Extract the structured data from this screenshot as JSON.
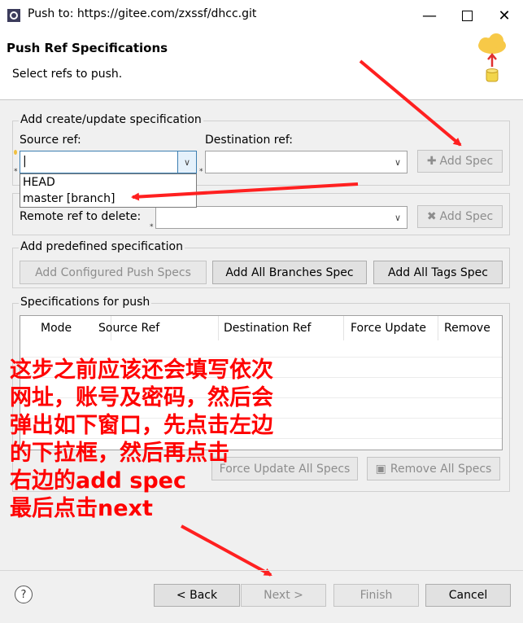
{
  "window": {
    "title": "Push to: https://gitee.com/zxssf/dhcc.git"
  },
  "header": {
    "title": "Push Ref Specifications",
    "description": "Select refs to push."
  },
  "create_update": {
    "group_label": "Add create/update specification",
    "source_label": "Source ref:",
    "source_value": "|",
    "destination_label": "Destination ref:",
    "add_spec_label": "Add Spec",
    "dropdown_items": [
      "HEAD",
      "master [branch]"
    ]
  },
  "delete": {
    "remote_label": "Remote ref to delete:",
    "add_spec_label": "Add Spec"
  },
  "predefined": {
    "group_label": "Add predefined specification",
    "configured_label": "Add Configured Push Specs",
    "all_branches_label": "Add All Branches Spec",
    "all_tags_label": "Add All Tags Spec"
  },
  "specs": {
    "group_label": "Specifications for push",
    "columns": [
      "Mode",
      "Source Ref",
      "Destination Ref",
      "Force Update",
      "Remove"
    ],
    "force_all_label": "Force Update All Specs",
    "remove_all_label": "Remove All Specs"
  },
  "annotation": {
    "lines": [
      "这步之前应该还会填写依次",
      "网址，账号及密码，然后会",
      "弹出如下窗口，先点击左边",
      "的下拉框，然后再点击",
      "右边的add spec",
      "最后点击next"
    ]
  },
  "footer": {
    "back_label": "< Back",
    "next_label": "Next >",
    "finish_label": "Finish",
    "cancel_label": "Cancel"
  },
  "colors": {
    "annotation": "#ff0000",
    "dialog_bg": "#f0f0f0",
    "header_bg": "#ffffff"
  }
}
